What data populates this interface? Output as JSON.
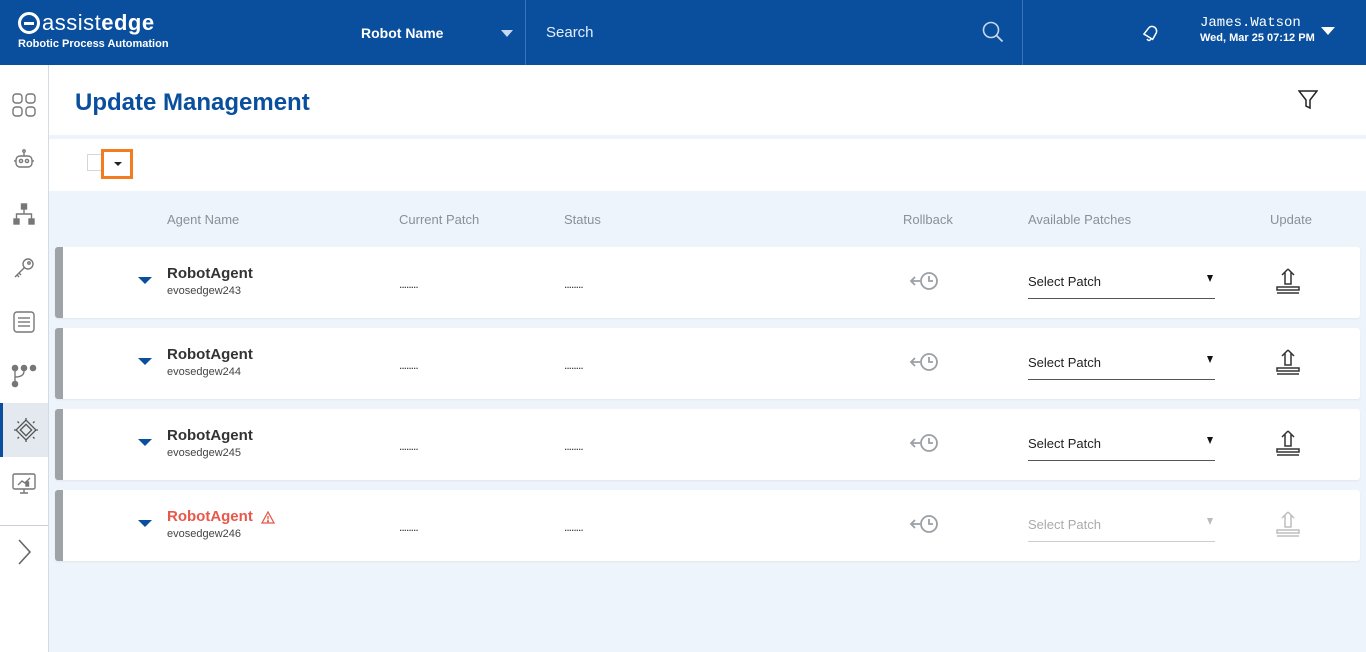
{
  "header": {
    "logo_prefix": "assist",
    "logo_bold": "edge",
    "logo_sub": "Robotic Process Automation",
    "robot_select": "Robot Name",
    "search_placeholder": "Search",
    "user_name": "James.Watson",
    "user_date": "Wed, Mar 25 07:12 PM"
  },
  "sidebar": {
    "items": [
      {
        "icon": "dashboard-grid-icon"
      },
      {
        "icon": "robot-icon"
      },
      {
        "icon": "hierarchy-icon"
      },
      {
        "icon": "key-icon"
      },
      {
        "icon": "list-document-icon"
      },
      {
        "icon": "workflow-icon"
      },
      {
        "icon": "chip-icon",
        "active": true
      },
      {
        "icon": "monitor-chart-icon"
      },
      {
        "icon": "expand-chevron-icon"
      }
    ]
  },
  "page": {
    "title": "Update Management"
  },
  "columns": {
    "agent_name": "Agent Name",
    "current_patch": "Current Patch",
    "status": "Status",
    "rollback": "Rollback",
    "available_patches": "Available Patches",
    "update": "Update"
  },
  "rows": [
    {
      "agent": "RobotAgent",
      "host": "evosedgew243",
      "current_patch": "........",
      "status": "........",
      "patch_placeholder": "Select Patch",
      "warning": false
    },
    {
      "agent": "RobotAgent",
      "host": "evosedgew244",
      "current_patch": "........",
      "status": "........",
      "patch_placeholder": "Select Patch",
      "warning": false
    },
    {
      "agent": "RobotAgent",
      "host": "evosedgew245",
      "current_patch": "........",
      "status": "........",
      "patch_placeholder": "Select Patch",
      "warning": false
    },
    {
      "agent": "RobotAgent",
      "host": "evosedgew246",
      "current_patch": "........",
      "status": "........",
      "patch_placeholder": "Select Patch",
      "warning": true
    }
  ],
  "colors": {
    "brand_blue": "#0a4f9e",
    "highlight_orange": "#f47c20",
    "warning_red": "#e8584a"
  }
}
